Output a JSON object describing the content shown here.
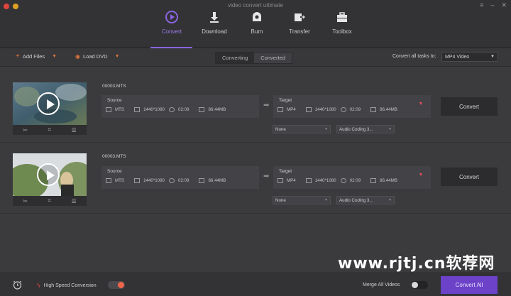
{
  "window": {
    "title": "video convert ultimate"
  },
  "nav": [
    {
      "label": "Convert",
      "icon": "convert-icon",
      "active": true
    },
    {
      "label": "Download",
      "icon": "download-icon"
    },
    {
      "label": "Burn",
      "icon": "burn-icon"
    },
    {
      "label": "Transfer",
      "icon": "transfer-icon"
    },
    {
      "label": "Toolbox",
      "icon": "toolbox-icon"
    }
  ],
  "toolbar": {
    "add_files": "Add Files",
    "load_dvd": "Load DVD",
    "tabs": [
      "Converting",
      "Converted"
    ],
    "convert_all_label": "Convert all tasks to:",
    "convert_all_format": "MP4 Video"
  },
  "items": [
    {
      "filename": "00003.MTS",
      "source": {
        "title": "Source",
        "format": "MTS",
        "resolution": "1440*1080",
        "duration": "02:09",
        "size": "86.44MB"
      },
      "target": {
        "title": "Target",
        "format": "MP4",
        "resolution": "1440*1080",
        "duration": "02:09",
        "size": "86.44MB"
      },
      "subtitle": "None",
      "audio": "Audio Coding 3...",
      "convert_label": "Convert"
    },
    {
      "filename": "00003.MTS",
      "source": {
        "title": "Source",
        "format": "MTS",
        "resolution": "1440*1080",
        "duration": "02:09",
        "size": "86.44MB"
      },
      "target": {
        "title": "Target",
        "format": "MP4",
        "resolution": "1440*1080",
        "duration": "02:09",
        "size": "86.44MB"
      },
      "subtitle": "None",
      "audio": "Audio Coding 3...",
      "convert_label": "Convert"
    }
  ],
  "bottom": {
    "high_speed": "High Speed Conversion",
    "high_speed_on": true,
    "merge": "Merge All Videos",
    "merge_on": false,
    "convert_all": "Convert All"
  },
  "watermark": "www.rjtj.cn软荐网",
  "colors": {
    "accent": "#8a63e0",
    "convert_all_bg": "#6b42c8",
    "orange": "#e0753a"
  }
}
